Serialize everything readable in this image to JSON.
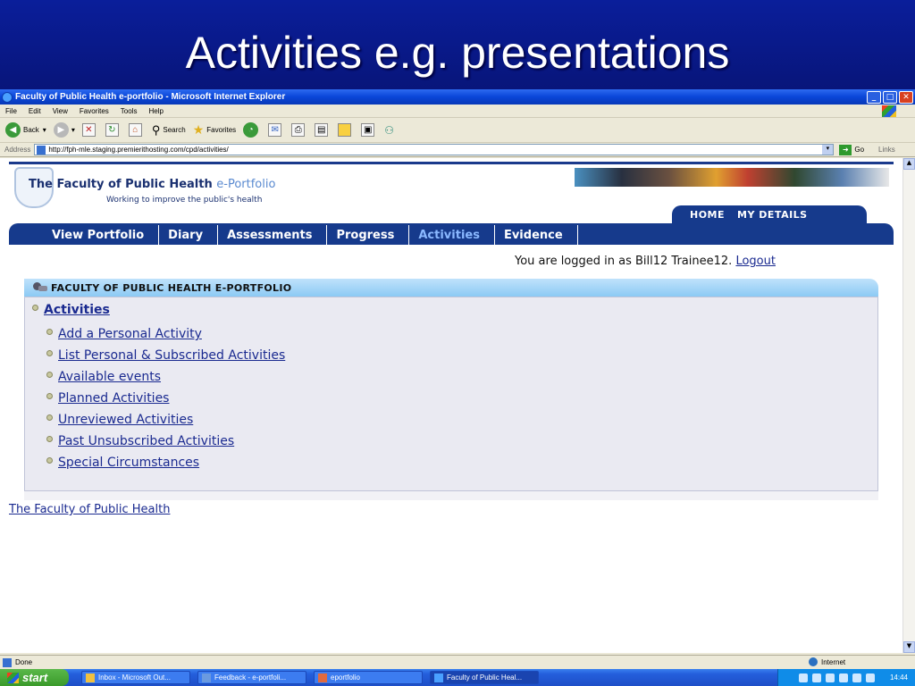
{
  "slide": {
    "title": "Activities e.g. presentations"
  },
  "window": {
    "title": "Faculty of Public Health e-portfolio - Microsoft Internet Explorer",
    "controls": {
      "minimize": "_",
      "maximize": "□",
      "close": "✕"
    }
  },
  "menubar": {
    "items": [
      "File",
      "Edit",
      "View",
      "Favorites",
      "Tools",
      "Help"
    ]
  },
  "toolbar": {
    "back": "Back",
    "search": "Search",
    "favorites": "Favorites"
  },
  "address": {
    "label": "Address",
    "url": "http://fph-mle.staging.premierithosting.com/cpd/activities/",
    "go": "Go",
    "links": "Links"
  },
  "site": {
    "name": "The Faculty of Public Health",
    "name_accent": "e-Portfolio",
    "tagline": "Working to improve the public's health",
    "top_tabs": [
      "HOME",
      "MY DETAILS"
    ],
    "nav": [
      {
        "label": "View Portfolio"
      },
      {
        "label": "Diary"
      },
      {
        "label": "Assessments"
      },
      {
        "label": "Progress"
      },
      {
        "label": "Activities",
        "active": true
      },
      {
        "label": "Evidence"
      }
    ],
    "login_text": "You are logged in as Bill12 Trainee12.",
    "logout": "Logout"
  },
  "panel": {
    "heading": "FACULTY OF PUBLIC HEALTH E-PORTFOLIO",
    "root": "Activities",
    "items": [
      "Add a Personal Activity",
      "List Personal & Subscribed Activities",
      "Available events",
      "Planned Activities",
      "Unreviewed Activities",
      "Past Unsubscribed Activities",
      "Special Circumstances"
    ]
  },
  "footer": {
    "link": "The Faculty of Public Health"
  },
  "status": {
    "left": "Done",
    "zone": "Internet"
  },
  "taskbar": {
    "start": "start",
    "tasks": [
      {
        "label": "Inbox - Microsoft Out..."
      },
      {
        "label": "Feedback - e-portfoli..."
      },
      {
        "label": "eportfolio"
      },
      {
        "label": "Faculty of Public Heal...",
        "active": true
      }
    ],
    "clock": "14:44"
  }
}
